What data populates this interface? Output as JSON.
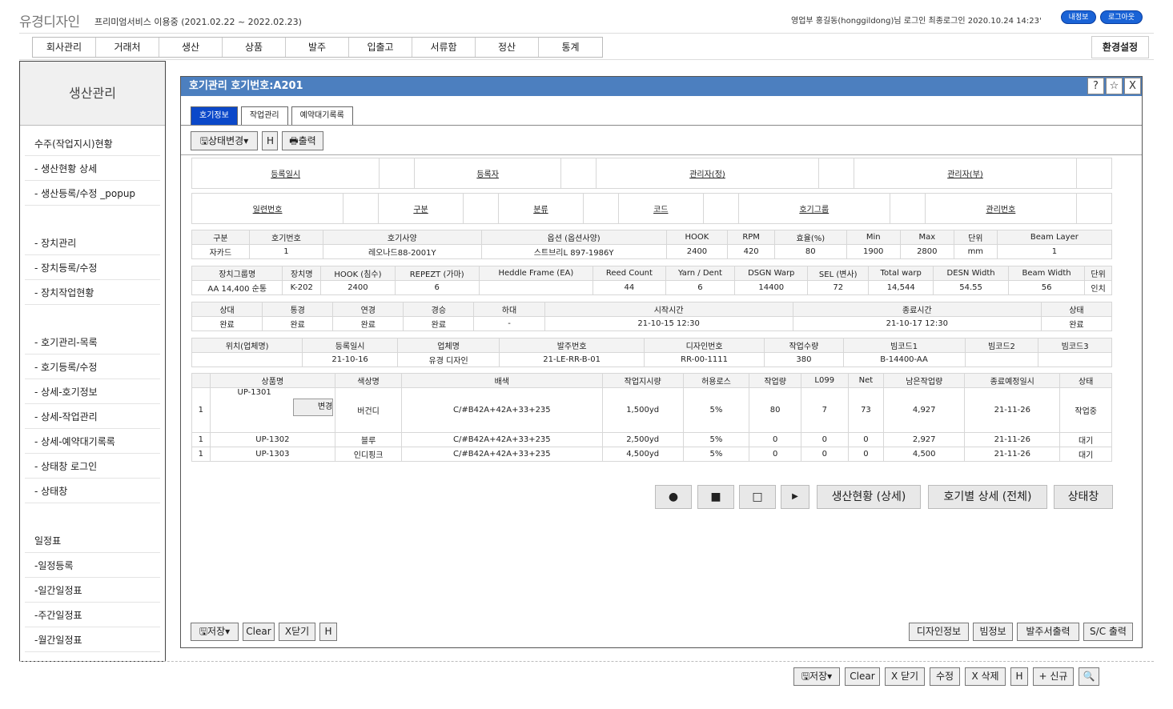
{
  "header": {
    "logo": "유경디자인",
    "service": "프리미엄서비스 이용중 (2021.02.22 ~ 2022.02.23)",
    "user": "영업부 홍길동(honggildong)님 로그인 최종로그인 2020.10.24 14:23'",
    "myinfo": "내정보",
    "logout": "로그아웃"
  },
  "menu": [
    "회사관리",
    "거래처",
    "생산",
    "상품",
    "발주",
    "입출고",
    "서류함",
    "정산",
    "통계"
  ],
  "settings": "환경설정",
  "sidebar": {
    "title": "생산관리",
    "items": [
      "수주(작업지시)현황",
      "- 생산현황 상세",
      "- 생산등록/수정 _popup",
      "- 장치관리",
      "- 장치등록/수정",
      "- 장치작업현황",
      "- 호기관리-목록",
      "- 호기등록/수정",
      "- 상세-호기정보",
      "- 상세-작업관리",
      "- 상세-예약대기록록",
      "- 상태창 로그인",
      "- 상태창",
      "일정표",
      "-일정등록",
      "-일간일정표",
      "-주간일정표",
      "-월간일정표"
    ]
  },
  "window": {
    "title": "호기관리 호기번호:A201",
    "help": "?",
    "star": "☆",
    "close": "X"
  },
  "tabs": [
    "호기정보",
    "작업관리",
    "예약대기록록"
  ],
  "toolbar": {
    "status": "상태변경",
    "h": "H",
    "print": "출력"
  },
  "reg": [
    "등록일시",
    "등록자",
    "관리자(정)",
    "관리자(부)"
  ],
  "ser": [
    "일련번호",
    "구분",
    "분류",
    "코드",
    "호기그룹",
    "관리번호"
  ],
  "t1": {
    "h": [
      "구분",
      "호기번호",
      "호기사양",
      "옵션 (옵션사양)",
      "HOOK",
      "RPM",
      "효율(%)",
      "Min",
      "Max",
      "단위",
      "Beam Layer"
    ],
    "r": [
      "자카드",
      "1",
      "레오나드88-2001Y",
      "스트브리L 897-1986Y",
      "2400",
      "420",
      "80",
      "1900",
      "2800",
      "mm",
      "1"
    ]
  },
  "t2": {
    "h": [
      "장치그룹명",
      "장치명",
      "HOOK (침수)",
      "REPEZT (가마)",
      "Heddle Frame (EA)",
      "Reed Count",
      "Yarn / Dent",
      "DSGN Warp",
      "SEL (변사)",
      "Total warp",
      "DESN Width",
      "Beam Width",
      "단위"
    ],
    "r": [
      "AA 14,400 순통",
      "K-202",
      "2400",
      "6",
      "",
      "44",
      "6",
      "14400",
      "72",
      "14,544",
      "54.55",
      "56",
      "인치"
    ]
  },
  "t3": {
    "h": [
      "상대",
      "통경",
      "연경",
      "경승",
      "하대",
      "시작시간",
      "종료시간",
      "상태"
    ],
    "r": [
      "완료",
      "완료",
      "완료",
      "완료",
      "-",
      "21-10-15 12:30",
      "21-10-17 12:30",
      "완료"
    ]
  },
  "t4": {
    "h": [
      "위치(업체명)",
      "등록일시",
      "업체명",
      "발주번호",
      "디자인번호",
      "작업수량",
      "빔코드1",
      "빔코드2",
      "빔코드3"
    ],
    "r": [
      "",
      "21-10-16",
      "유경 디자인",
      "21-LE-RR-B-01",
      "RR-00-1111",
      "380",
      "B-14400-AA",
      "",
      ""
    ]
  },
  "t5": {
    "h": [
      "",
      "상품명",
      "색상명",
      "배색",
      "작업지시량",
      "허용로스",
      "작업량",
      "L099",
      "Net",
      "남은작업량",
      "종료예정일시",
      "상태"
    ],
    "rows": [
      [
        "1",
        "UP-1301",
        "버건디",
        "C/#B42A+42A+33+235",
        "1,500yd",
        "5%",
        "80",
        "7",
        "73",
        "4,927",
        "21-11-26",
        "작업중"
      ],
      [
        "1",
        "UP-1302",
        "블루",
        "C/#B42A+42A+33+235",
        "2,500yd",
        "5%",
        "0",
        "0",
        "0",
        "2,927",
        "21-11-26",
        "대기"
      ],
      [
        "1",
        "UP-1303",
        "인디핑크",
        "C/#B42A+42A+33+235",
        "4,500yd",
        "5%",
        "0",
        "0",
        "0",
        "4,500",
        "21-11-26",
        "대기"
      ]
    ],
    "change": "변경"
  },
  "ctrl": {
    "circle": "●",
    "square": "■",
    "empty": "□",
    "play": "▶",
    "b1": "생산현황 (상세)",
    "b2": "호기별 상세 (전체)",
    "b3": "상태창"
  },
  "bottom": {
    "save": "저장",
    "clear": "Clear",
    "close": "X닫기",
    "h": "H",
    "design": "디자인정보",
    "beam": "빔정보",
    "order": "발주서출력",
    "sc": "S/C 출력"
  },
  "footer": {
    "save": "저장",
    "clear": "Clear",
    "close": "X 닫기",
    "edit": "수정",
    "del": "X 삭제",
    "h": "H",
    "new": "+ 신규",
    "search": "🔍"
  }
}
